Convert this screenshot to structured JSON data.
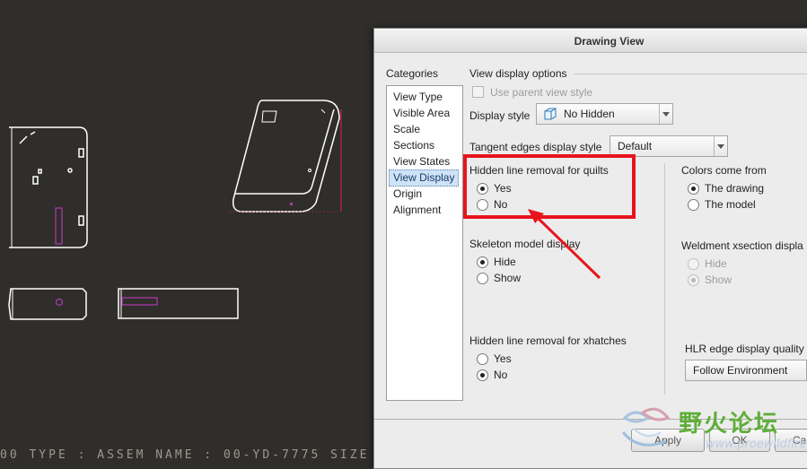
{
  "status_bar": {
    "text": "00  TYPE : ASSEM  NAME : 00-YD-7775  SIZE :"
  },
  "dialog": {
    "title": "Drawing View",
    "categories_label": "Categories",
    "categories": [
      {
        "label": "View Type"
      },
      {
        "label": "Visible Area"
      },
      {
        "label": "Scale"
      },
      {
        "label": "Sections"
      },
      {
        "label": "View States"
      },
      {
        "label": "View Display",
        "selected": true
      },
      {
        "label": "Origin"
      },
      {
        "label": "Alignment"
      }
    ],
    "section_title": "View display options",
    "use_parent_label": "Use parent view style",
    "display_style": {
      "label": "Display style",
      "value": "No Hidden"
    },
    "tangent_edges": {
      "label": "Tangent edges display style",
      "value": "Default"
    },
    "hlr_quilts": {
      "label": "Hidden line removal for quilts",
      "options": [
        "Yes",
        "No"
      ],
      "selected": "Yes"
    },
    "skeleton": {
      "label": "Skeleton model display",
      "options": [
        "Hide",
        "Show"
      ],
      "selected": "Hide"
    },
    "hlr_xhatches": {
      "label": "Hidden line removal for xhatches",
      "options": [
        "Yes",
        "No"
      ],
      "selected": "No"
    },
    "colors_from": {
      "label": "Colors come from",
      "options": [
        "The drawing",
        "The model"
      ],
      "selected": "The drawing"
    },
    "weldment": {
      "label": "Weldment xsection displa",
      "options": [
        "Hide",
        "Show"
      ],
      "selected": "Show"
    },
    "hlr_edge_quality": {
      "label": "HLR edge display quality",
      "value": "Follow Environment"
    },
    "buttons": {
      "apply": "Apply",
      "ok": "OK",
      "cancel": "Can"
    }
  },
  "watermark": {
    "text": "野火论坛",
    "url": "www.proewildfire.cn"
  },
  "colors": {
    "highlight": "#e8141c",
    "selection": "#cfe3f7",
    "background": "#302e2b"
  }
}
